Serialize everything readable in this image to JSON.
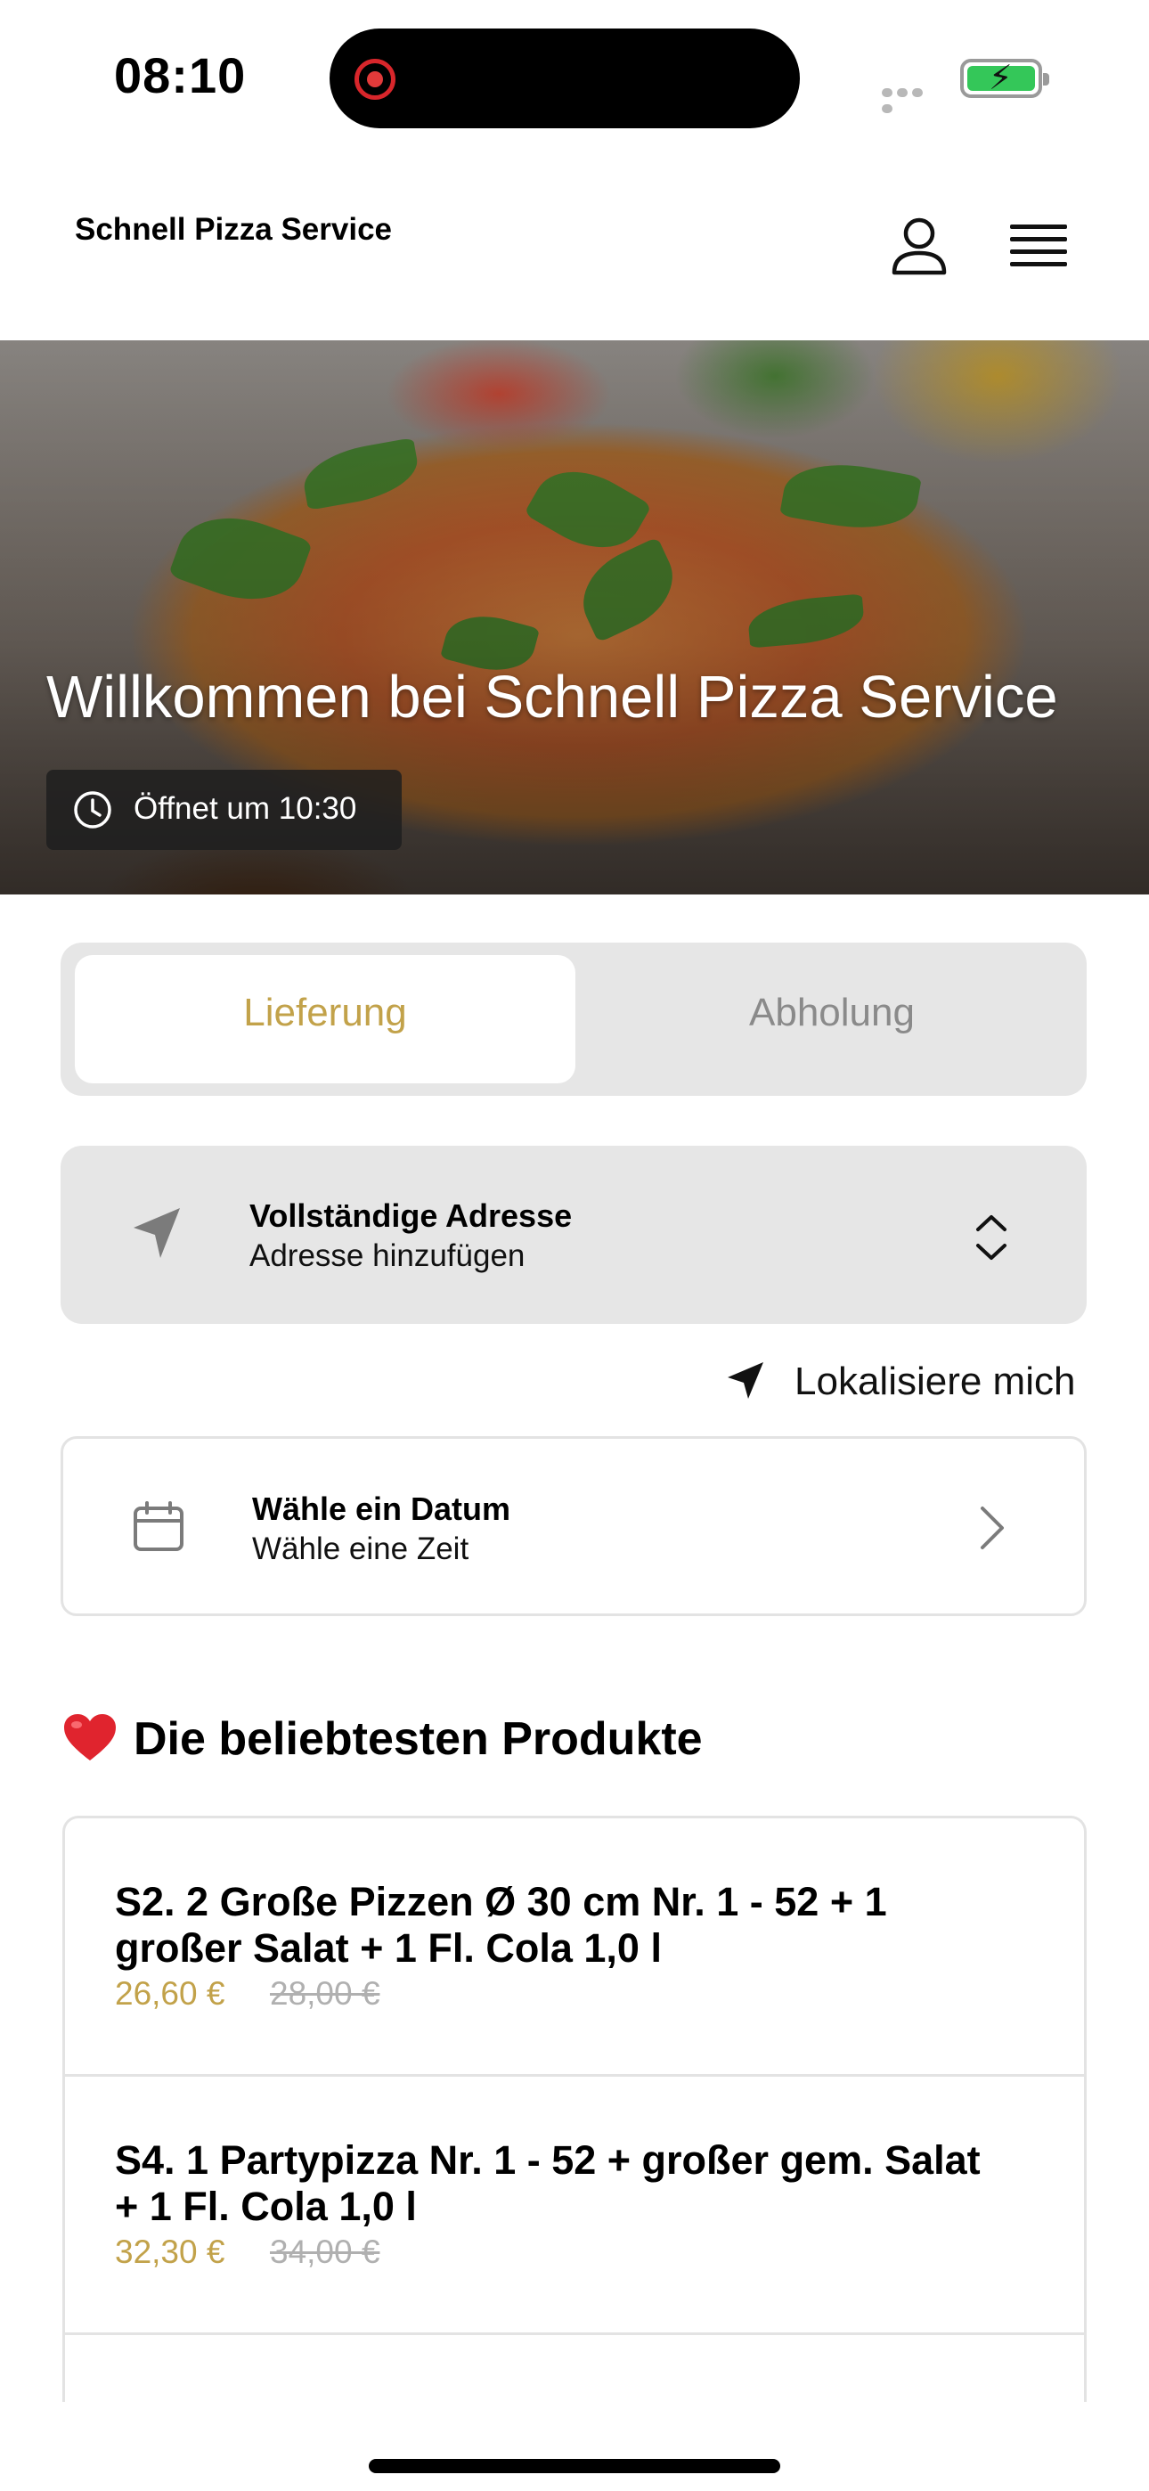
{
  "status_bar": {
    "time": "08:10"
  },
  "header": {
    "brand": "Schnell Pizza Service"
  },
  "hero": {
    "title": "Willkommen bei Schnell Pizza Service",
    "opening": "Öffnet um 10:30"
  },
  "order_mode": {
    "options": [
      "Lieferung",
      "Abholung"
    ],
    "selected": "Lieferung"
  },
  "address": {
    "title": "Vollständige Adresse",
    "subtitle": "Adresse hinzufügen",
    "locate_label": "Lokalisiere mich"
  },
  "schedule": {
    "title": "Wähle ein Datum",
    "subtitle": "Wähle eine Zeit"
  },
  "popular": {
    "title": "Die beliebtesten Produkte",
    "products": [
      {
        "name": "S2. 2 Große Pizzen Ø 30 cm Nr. 1 - 52 + 1 großer Salat + 1 Fl. Cola 1,0 l",
        "price": "26,60 €",
        "old_price": "28,00 €"
      },
      {
        "name": "S4. 1 Partypizza Nr. 1 - 52 + großer gem. Salat + 1 Fl. Cola 1,0 l",
        "price": "32,30 €",
        "old_price": "34,00 €"
      }
    ]
  },
  "colors": {
    "accent": "#c2a24a",
    "panel": "#e6e6e6",
    "battery": "#34c759"
  },
  "icons": [
    "record-icon",
    "signal-icon",
    "battery-icon",
    "profile-icon",
    "menu-icon",
    "clock-icon",
    "navigation-arrow-icon",
    "chevron-up-down-icon",
    "location-arrow-icon",
    "calendar-icon",
    "chevron-right-icon",
    "heart-icon"
  ]
}
